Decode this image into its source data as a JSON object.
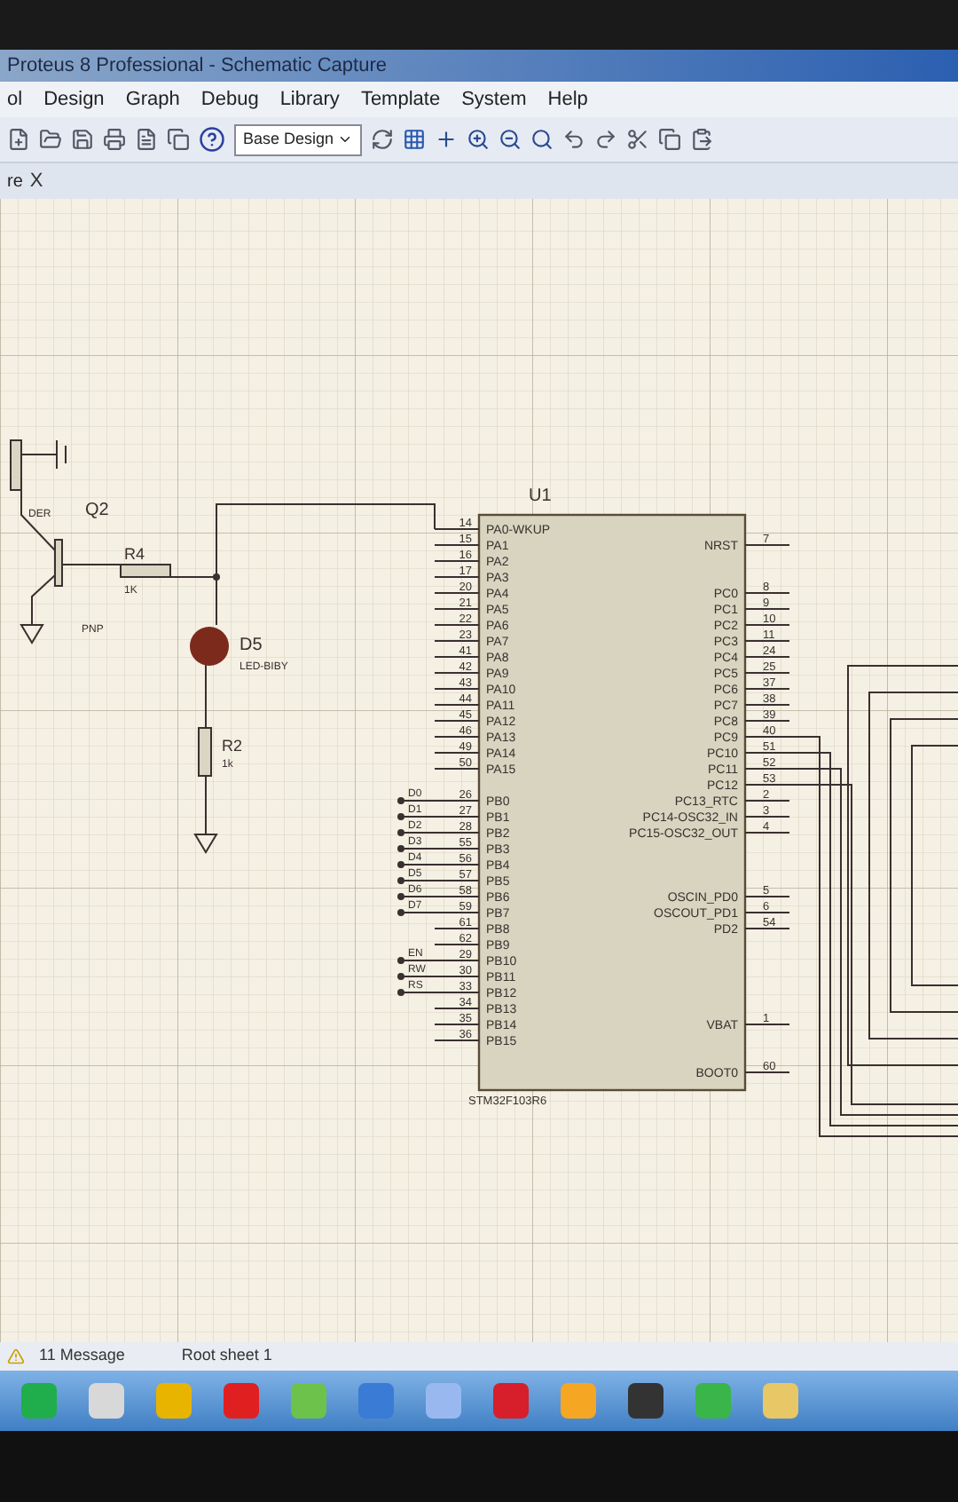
{
  "window": {
    "title": "Proteus 8 Professional - Schematic Capture"
  },
  "menu": [
    "ol",
    "Design",
    "Graph",
    "Debug",
    "Library",
    "Template",
    "System",
    "Help"
  ],
  "toolbar": {
    "design_select": "Base Design"
  },
  "tab": {
    "label": "re",
    "close": "X"
  },
  "schematic": {
    "transistor": {
      "ref": "Q2",
      "type": "PNP",
      "sensor_label": "DER"
    },
    "r4": {
      "ref": "R4",
      "value": "1K"
    },
    "led": {
      "ref": "D5",
      "value": "LED-BIBY"
    },
    "r2": {
      "ref": "R2",
      "value": "1k"
    },
    "chip": {
      "ref": "U1",
      "part": "STM32F103R6",
      "left_pin_groups": [
        {
          "pins": [
            {
              "number": "14",
              "name": "PA0-WKUP"
            },
            {
              "number": "15",
              "name": "PA1"
            },
            {
              "number": "16",
              "name": "PA2"
            },
            {
              "number": "17",
              "name": "PA3"
            },
            {
              "number": "20",
              "name": "PA4"
            },
            {
              "number": "21",
              "name": "PA5"
            },
            {
              "number": "22",
              "name": "PA6"
            },
            {
              "number": "23",
              "name": "PA7"
            },
            {
              "number": "41",
              "name": "PA8"
            },
            {
              "number": "42",
              "name": "PA9"
            },
            {
              "number": "43",
              "name": "PA10"
            },
            {
              "number": "44",
              "name": "PA11"
            },
            {
              "number": "45",
              "name": "PA12"
            },
            {
              "number": "46",
              "name": "PA13"
            },
            {
              "number": "49",
              "name": "PA14"
            },
            {
              "number": "50",
              "name": "PA15"
            }
          ]
        },
        {
          "pins": [
            {
              "number": "26",
              "name": "PB0",
              "net": "D0"
            },
            {
              "number": "27",
              "name": "PB1",
              "net": "D1"
            },
            {
              "number": "28",
              "name": "PB2",
              "net": "D2"
            },
            {
              "number": "55",
              "name": "PB3",
              "net": "D3"
            },
            {
              "number": "56",
              "name": "PB4",
              "net": "D4"
            },
            {
              "number": "57",
              "name": "PB5",
              "net": "D5"
            },
            {
              "number": "58",
              "name": "PB6",
              "net": "D6"
            },
            {
              "number": "59",
              "name": "PB7",
              "net": "D7"
            },
            {
              "number": "61",
              "name": "PB8"
            },
            {
              "number": "62",
              "name": "PB9"
            },
            {
              "number": "29",
              "name": "PB10",
              "net": "EN"
            },
            {
              "number": "30",
              "name": "PB11",
              "net": "RW"
            },
            {
              "number": "33",
              "name": "PB12",
              "net": "RS"
            },
            {
              "number": "34",
              "name": "PB13"
            },
            {
              "number": "35",
              "name": "PB14"
            },
            {
              "number": "36",
              "name": "PB15"
            }
          ]
        }
      ],
      "right_pin_groups": [
        {
          "pins": [
            {
              "number": "7",
              "name": "NRST"
            }
          ]
        },
        {
          "pins": [
            {
              "number": "8",
              "name": "PC0"
            },
            {
              "number": "9",
              "name": "PC1"
            },
            {
              "number": "10",
              "name": "PC2"
            },
            {
              "number": "11",
              "name": "PC3"
            },
            {
              "number": "24",
              "name": "PC4"
            },
            {
              "number": "25",
              "name": "PC5"
            },
            {
              "number": "37",
              "name": "PC6"
            },
            {
              "number": "38",
              "name": "PC7"
            },
            {
              "number": "39",
              "name": "PC8"
            },
            {
              "number": "40",
              "name": "PC9"
            },
            {
              "number": "51",
              "name": "PC10"
            },
            {
              "number": "52",
              "name": "PC11"
            },
            {
              "number": "53",
              "name": "PC12"
            },
            {
              "number": "2",
              "name": "PC13_RTC"
            },
            {
              "number": "3",
              "name": "PC14-OSC32_IN"
            },
            {
              "number": "4",
              "name": "PC15-OSC32_OUT"
            }
          ]
        },
        {
          "pins": [
            {
              "number": "5",
              "name": "OSCIN_PD0"
            },
            {
              "number": "6",
              "name": "OSCOUT_PD1"
            },
            {
              "number": "54",
              "name": "PD2"
            }
          ]
        },
        {
          "pins": [
            {
              "number": "1",
              "name": "VBAT"
            }
          ]
        },
        {
          "pins": [
            {
              "number": "60",
              "name": "BOOT0"
            }
          ]
        }
      ]
    }
  },
  "status_bar": {
    "messages": "11 Message",
    "sheet": "Root sheet 1"
  }
}
